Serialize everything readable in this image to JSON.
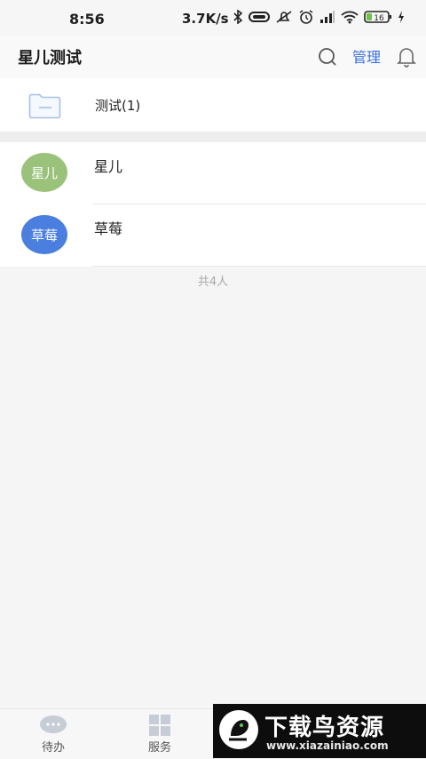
{
  "status_bar": {
    "time": "8:56",
    "net_speed": "3.7K/s",
    "battery": "16"
  },
  "header": {
    "title": "星儿测试",
    "manage_label": "管理"
  },
  "folder": {
    "label": "测试(1)"
  },
  "members": [
    {
      "avatar_text": "星儿",
      "name": "星儿",
      "avatar_color": "#9bc27a"
    },
    {
      "avatar_text": "草莓",
      "name": "草莓",
      "avatar_color": "#4a7fe0"
    }
  ],
  "total_label": "共4人",
  "tabs": [
    {
      "label": "待办",
      "icon": "chat-bubble-icon"
    },
    {
      "label": "服务",
      "icon": "grid-icon"
    }
  ],
  "watermark": {
    "text": "下载鸟资源",
    "url": "www.xiazainiao.com"
  },
  "colors": {
    "accent": "#3a6fd8",
    "background": "#f5f5f5"
  }
}
